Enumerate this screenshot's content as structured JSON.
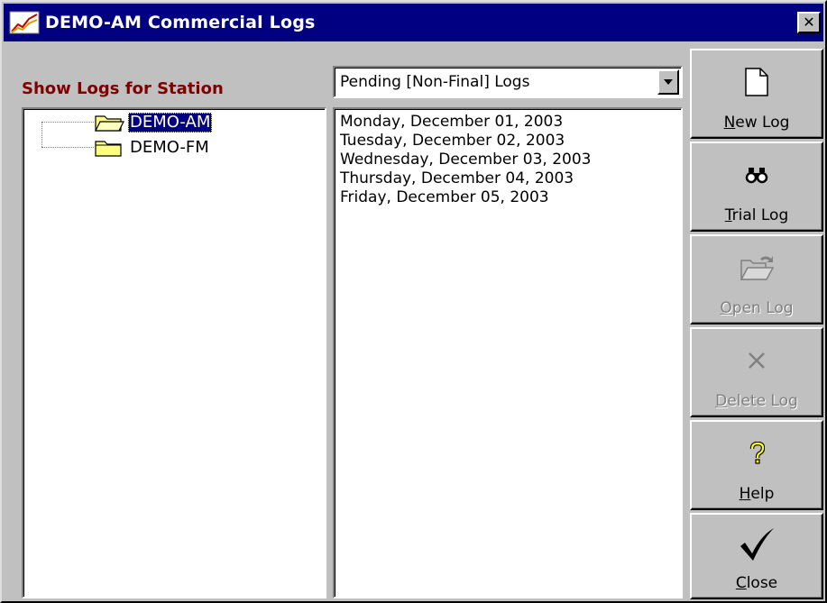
{
  "window": {
    "title": "DEMO-AM Commercial Logs",
    "close_glyph": "✕"
  },
  "stations": {
    "label": "Show Logs for Station",
    "items": [
      {
        "label": "DEMO-AM",
        "selected": true,
        "icon": "open-folder-icon"
      },
      {
        "label": "DEMO-FM",
        "selected": false,
        "icon": "folder-icon"
      }
    ]
  },
  "filter": {
    "selected": "Pending [Non-Final] Logs"
  },
  "logs": [
    "Monday, December 01, 2003",
    "Tuesday, December 02, 2003",
    "Wednesday, December 03, 2003",
    "Thursday, December 04, 2003",
    "Friday, December 05, 2003"
  ],
  "buttons": {
    "new_log": {
      "accel": "N",
      "rest": "ew Log",
      "enabled": true,
      "icon": "new-document-icon"
    },
    "trial_log": {
      "accel": "T",
      "rest": "rial Log",
      "enabled": true,
      "icon": "binoculars-icon"
    },
    "open_log": {
      "accel": "O",
      "rest": "pen Log",
      "enabled": false,
      "icon": "open-folder-icon"
    },
    "delete_log": {
      "accel": "D",
      "rest": "elete Log",
      "enabled": false,
      "icon": "delete-x-icon"
    },
    "help": {
      "accel": "H",
      "rest": "elp",
      "enabled": true,
      "icon": "question-mark-icon"
    },
    "close": {
      "accel": "C",
      "rest": "lose",
      "enabled": true,
      "icon": "checkmark-icon"
    }
  },
  "colors": {
    "titlebar": "#000080",
    "station_label": "#800000",
    "face": "#c0c0c0",
    "selection": "#000080"
  }
}
